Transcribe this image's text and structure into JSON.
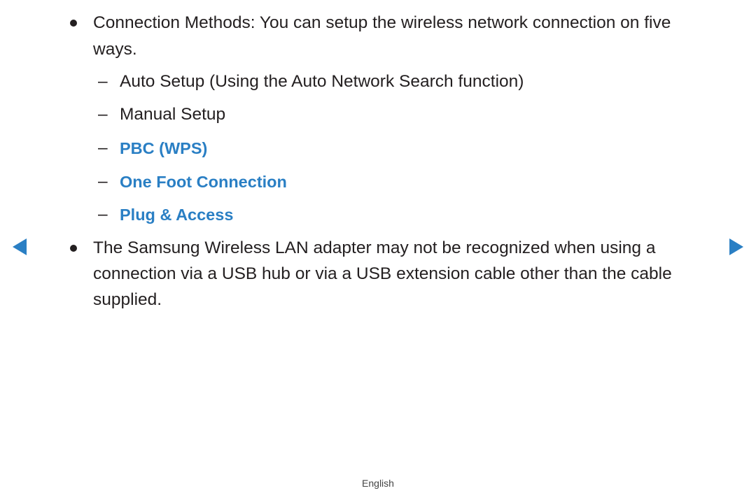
{
  "section1": {
    "line1": "Connection Methods: You can setup the wireless network connection on five",
    "line2": "ways.",
    "items": [
      {
        "label": "Auto Setup (Using the Auto Network Search function)",
        "link": false
      },
      {
        "label": "Manual Setup",
        "link": false
      },
      {
        "label": "PBC (WPS)",
        "link": true
      },
      {
        "label": "One Foot Connection",
        "link": true
      },
      {
        "label": "Plug & Access",
        "link": true
      }
    ],
    "dash": "–"
  },
  "section2": {
    "line1": "The Samsung Wireless LAN adapter may not be recognized when using a",
    "line2": "connection via a USB hub or via a USB extension cable other than the cable",
    "line3": "supplied."
  },
  "navigation": {
    "prev_icon": "left-triangle-icon",
    "next_icon": "right-triangle-icon",
    "accent_color": "#2a7fc4"
  },
  "footer": {
    "language": "English"
  }
}
